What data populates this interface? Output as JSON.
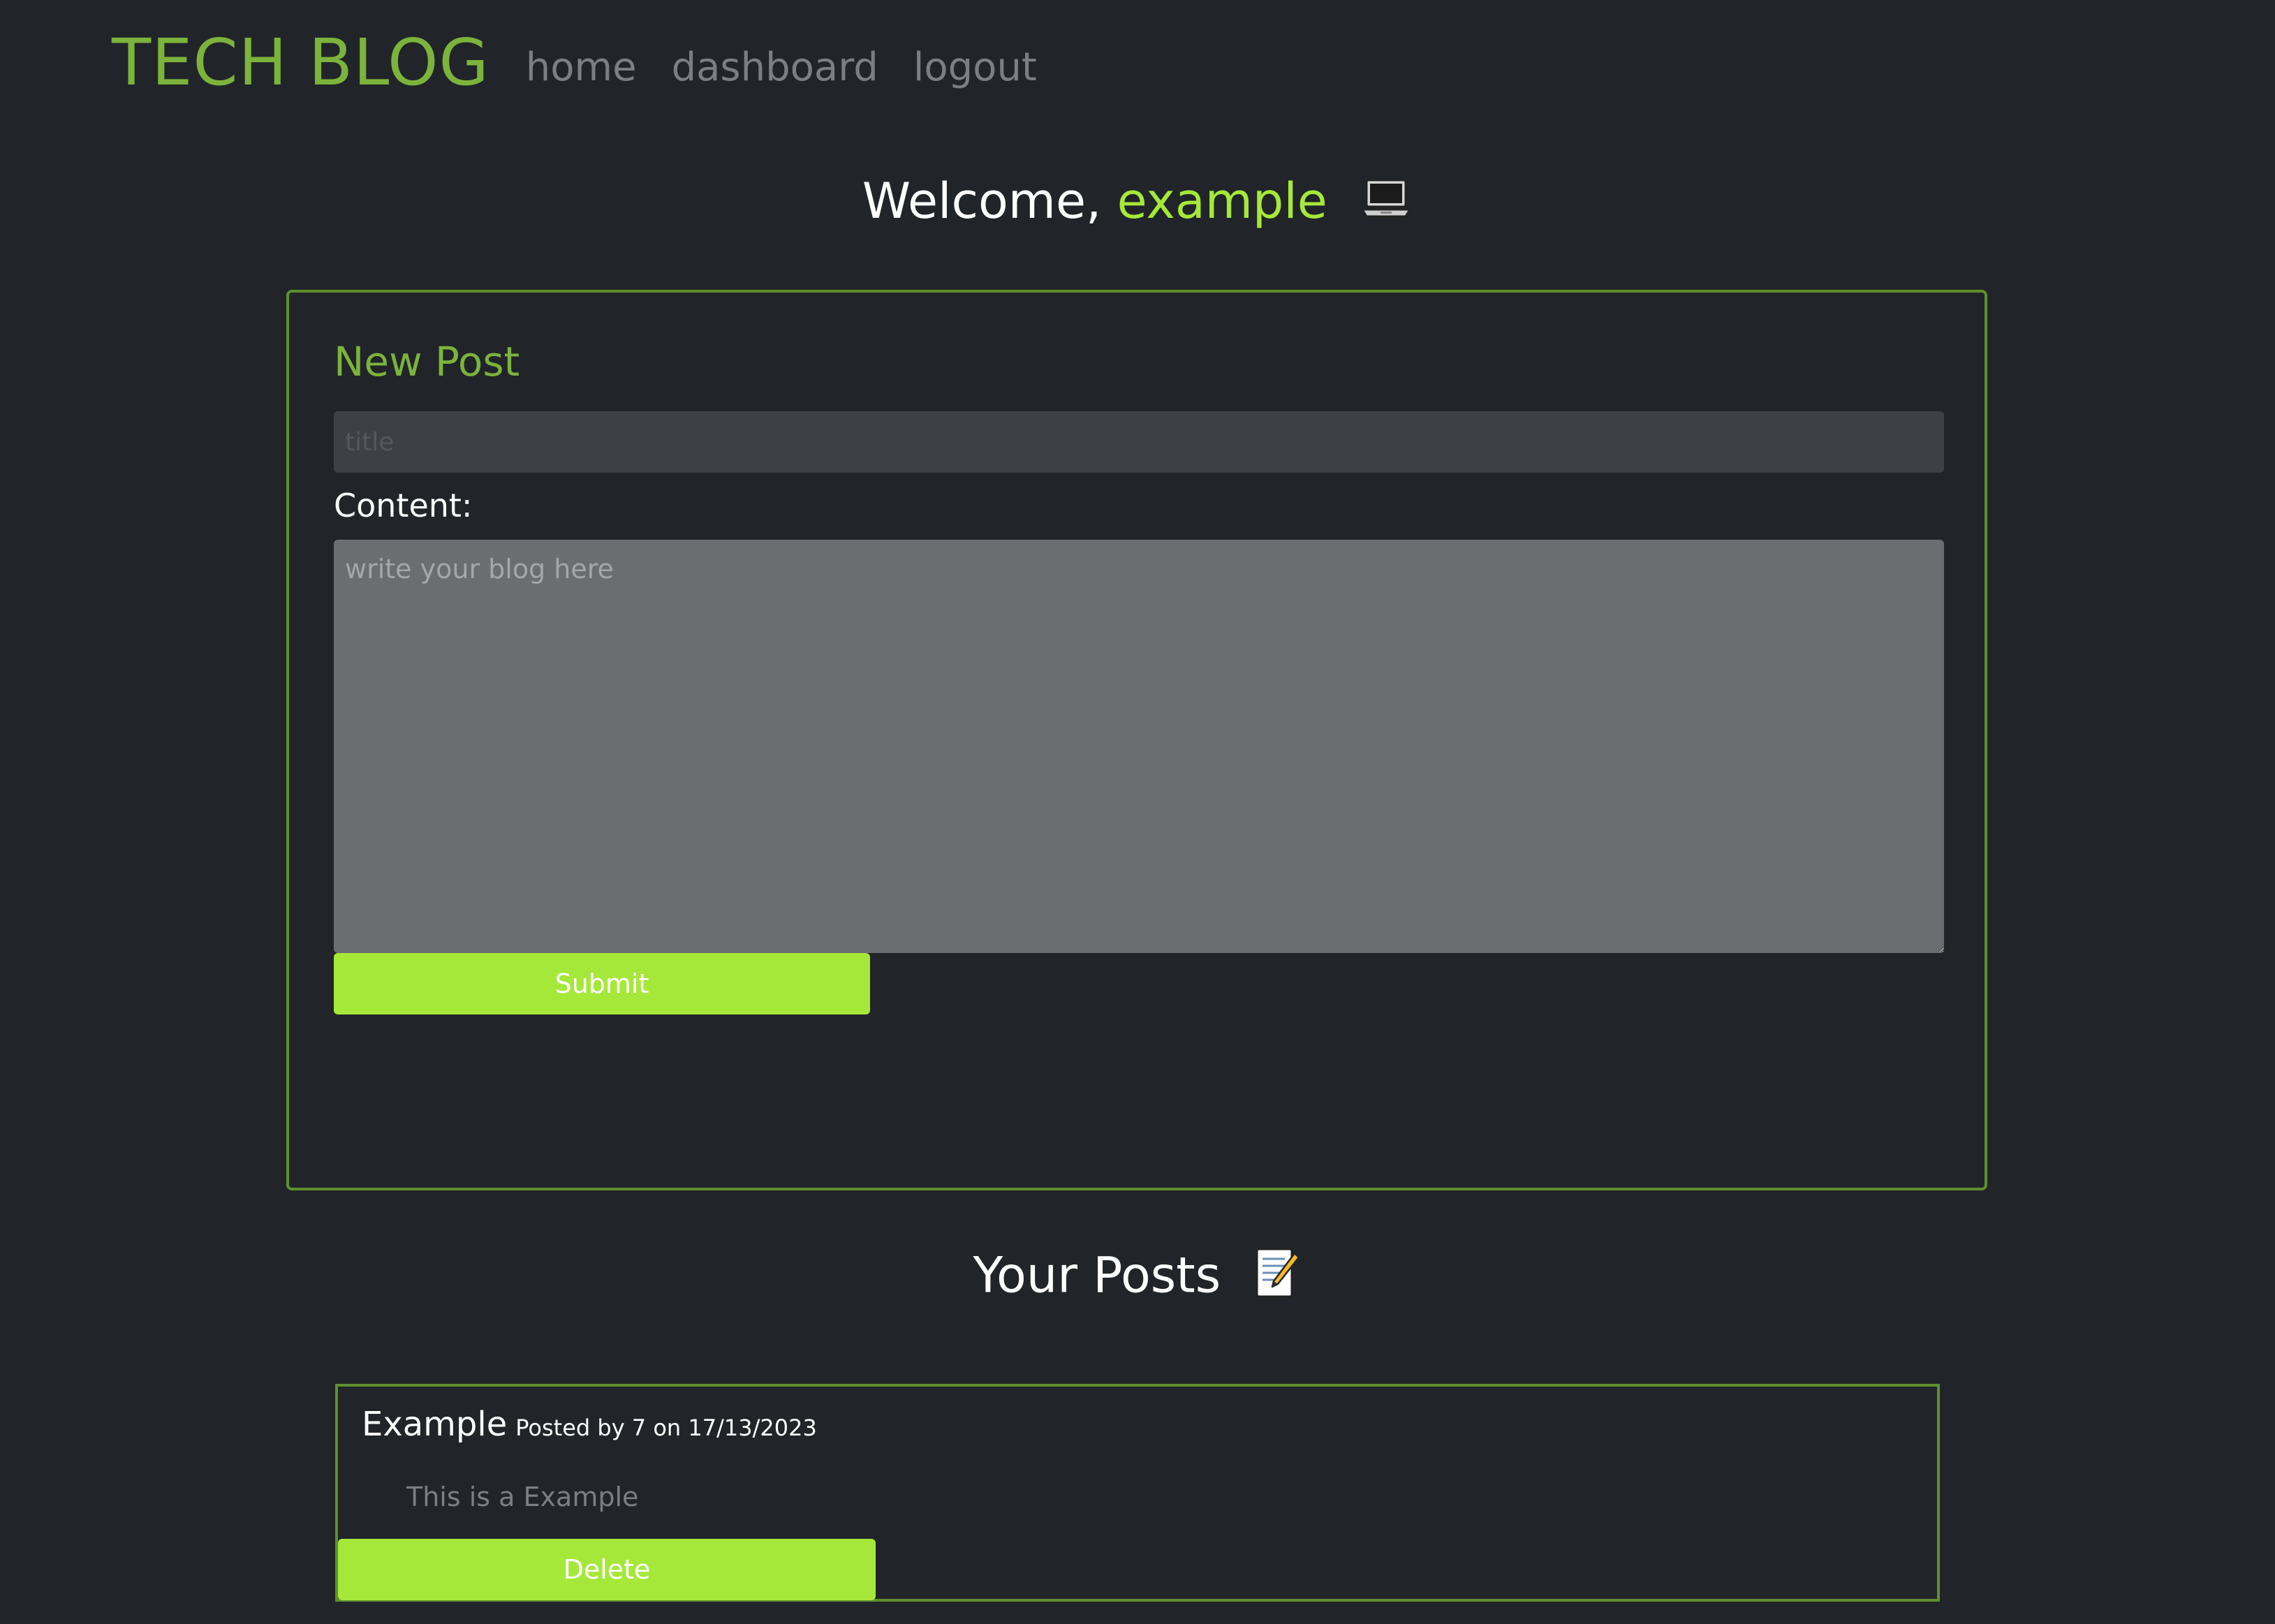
{
  "nav": {
    "brand": "TECH BLOG",
    "links": [
      "home",
      "dashboard",
      "logout"
    ]
  },
  "welcome": {
    "prefix": "Welcome, ",
    "username": "example",
    "icon": "laptop-icon"
  },
  "new_post": {
    "heading": "New Post",
    "title_placeholder": "title",
    "title_value": "",
    "content_label": "Content:",
    "content_placeholder": "write your blog here",
    "content_value": "",
    "submit_label": "Submit"
  },
  "your_posts": {
    "heading": "Your Posts",
    "icon": "memo-icon",
    "posts": [
      {
        "title": "Example",
        "meta": "Posted by 7 on 17/13/2023",
        "body": "This is a Example",
        "delete_label": "Delete"
      }
    ]
  },
  "colors": {
    "background": "#212529",
    "brand_green": "#7cb33c",
    "accent_green": "#a6e83a",
    "border_green": "#5f8f2e",
    "nav_link": "#7b7f83"
  }
}
